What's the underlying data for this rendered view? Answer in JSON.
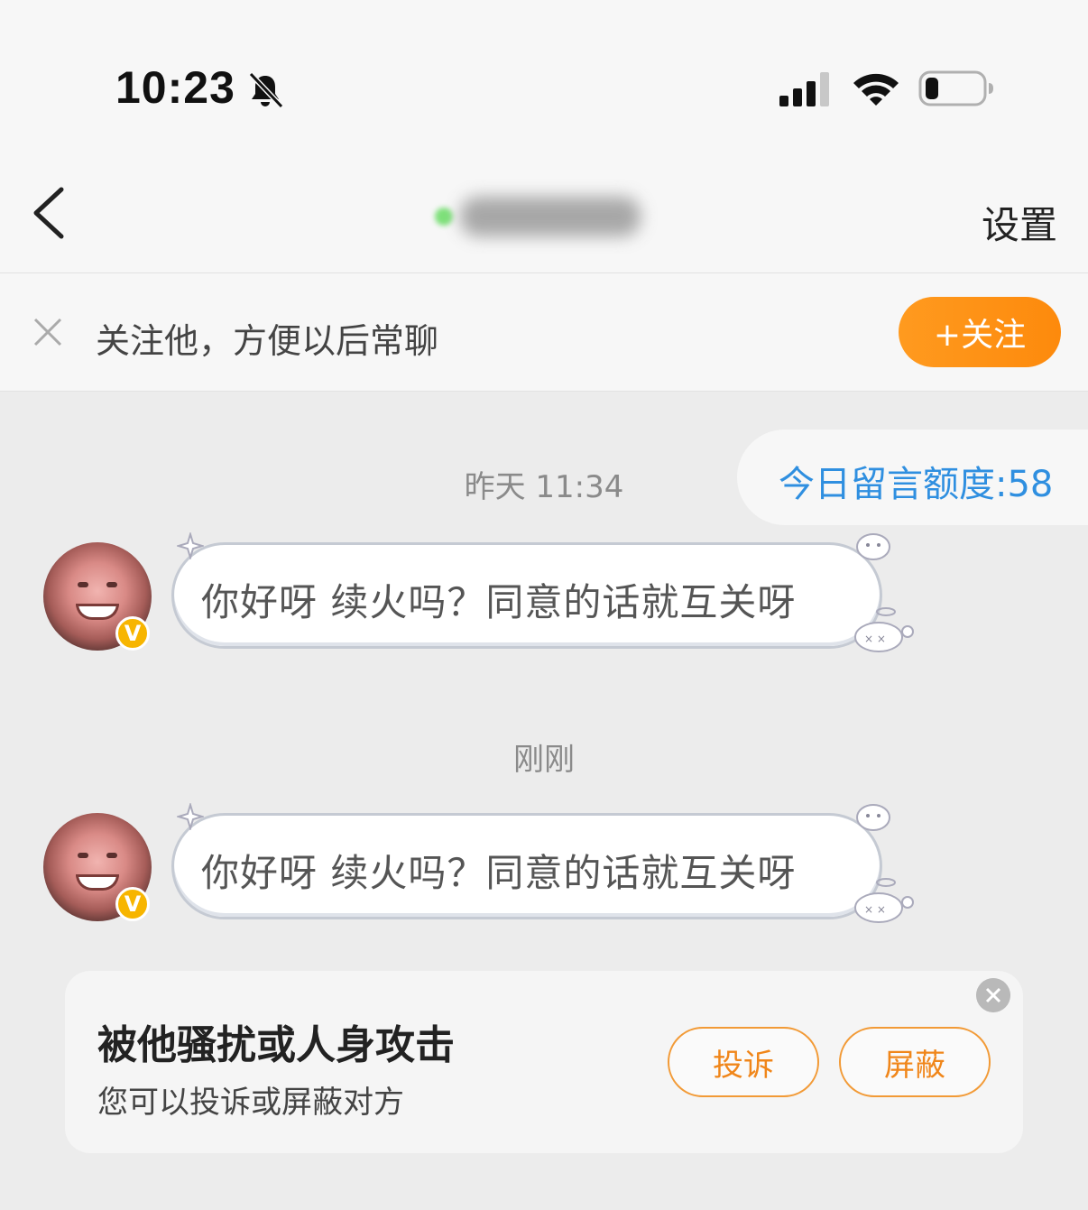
{
  "status_bar": {
    "time": "10:23"
  },
  "nav": {
    "settings_label": "设置"
  },
  "follow_bar": {
    "tip": "关注他，方便以后常聊",
    "button_label": "+关注"
  },
  "chat": {
    "quota": "今日留言额度:58",
    "messages": [
      {
        "timestamp": "昨天 11:34",
        "text": "你好呀 续火吗？同意的话就互关呀"
      },
      {
        "timestamp": "刚刚",
        "text": "你好呀 续火吗？同意的话就互关呀"
      }
    ],
    "badge": "V"
  },
  "report": {
    "title": "被他骚扰或人身攻击",
    "subtitle": "您可以投诉或屏蔽对方",
    "complain_label": "投诉",
    "block_label": "屏蔽"
  }
}
